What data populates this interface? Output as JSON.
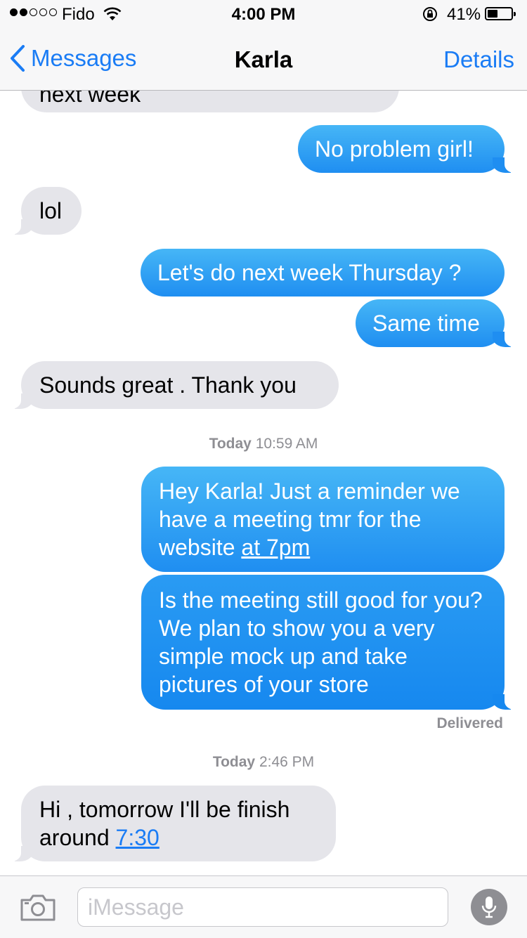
{
  "status_bar": {
    "carrier": "Fido",
    "time": "4:00 PM",
    "battery_percent": "41%",
    "battery_level": 0.41,
    "signal_bars_filled": 2,
    "signal_bars_total": 5,
    "icons": [
      "wifi-icon",
      "rotation-lock-icon",
      "battery-icon"
    ]
  },
  "nav": {
    "back_label": "Messages",
    "title": "Karla",
    "details_label": "Details"
  },
  "messages": [
    {
      "direction": "incoming",
      "text": "next week",
      "partially_hidden": true
    },
    {
      "direction": "outgoing",
      "text": "No problem girl!"
    },
    {
      "direction": "incoming",
      "text": "lol"
    },
    {
      "direction": "outgoing",
      "text": "Let's do next week Thursday ?"
    },
    {
      "direction": "outgoing",
      "text": "Same time"
    },
    {
      "direction": "incoming",
      "text": "Sounds great . Thank you"
    },
    {
      "timestamp_day": "Today",
      "timestamp_time": "10:59 AM"
    },
    {
      "direction": "outgoing",
      "text": "Hey Karla! Just a reminder we have a meeting tmr for the website ",
      "link": "at 7pm"
    },
    {
      "direction": "outgoing",
      "text": "Is the meeting still good for you? We plan to show you a very simple mock up and take pictures of your store"
    },
    {
      "status": "Delivered"
    },
    {
      "timestamp_day": "Today",
      "timestamp_time": "2:46 PM"
    },
    {
      "direction": "incoming",
      "text": "Hi , tomorrow I'll be finish around ",
      "link": "7:30"
    }
  ],
  "compose": {
    "placeholder": "iMessage",
    "value": ""
  },
  "colors": {
    "accent": "#1a7cf5",
    "outgoing_bubble": "#2a9bf3",
    "incoming_bubble": "#e5e5ea",
    "meta_text": "#8e8e93"
  }
}
